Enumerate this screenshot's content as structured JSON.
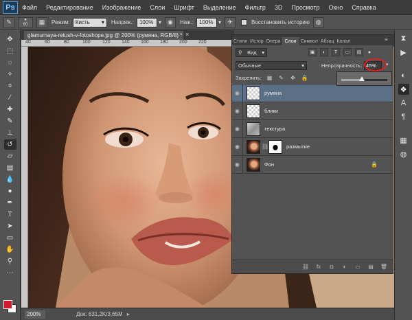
{
  "app": {
    "logo": "Ps"
  },
  "menu": [
    "Файл",
    "Редактирование",
    "Изображение",
    "Слои",
    "Шрифт",
    "Выделение",
    "Фильтр",
    "3D",
    "Просмотр",
    "Окно",
    "Справка"
  ],
  "options": {
    "brush_size": "60",
    "mode_label": "Режим:",
    "mode_value": "Кисть",
    "pressure_label": "Напряж.:",
    "pressure_value": "100%",
    "flow_label": "Наж.:",
    "flow_value": "100%",
    "restore_label": "Восстановить историю"
  },
  "document": {
    "tab_title": "glamurnaya-retush-v-fotoshope.jpg @ 200% (румяна, RGB/8) *",
    "close": "×",
    "ruler_numbers": [
      "40",
      "60",
      "80",
      "100",
      "120",
      "140",
      "160",
      "180",
      "200",
      "220"
    ],
    "zoom": "200%",
    "doc_size": "Док: 631,2K/3,65M"
  },
  "layers_panel": {
    "tabs": [
      "Стили",
      "Истор",
      "Опера",
      "Слои",
      "Символ",
      "Абзац",
      "Канал"
    ],
    "active_tab": "Слои",
    "filter_kind": "Вид",
    "blend_mode": "Обычные",
    "opacity_label": "Непрозрачность:",
    "opacity_value": "45%",
    "opacity": 0.45,
    "lock_label": "Закрепить:",
    "layers": [
      {
        "name": "румяна",
        "thumb": "transparent",
        "selected": true
      },
      {
        "name": "блики",
        "thumb": "transparent",
        "selected": false
      },
      {
        "name": "текстура",
        "thumb": "texture",
        "selected": false
      },
      {
        "name": "размытие",
        "thumb": "face",
        "mask": true,
        "selected": false
      },
      {
        "name": "Фон",
        "thumb": "face",
        "locked": true,
        "selected": false
      }
    ]
  },
  "colors": {
    "foreground": "#d5172b",
    "background": "#ffffff",
    "accent_ring": "#e02020"
  }
}
